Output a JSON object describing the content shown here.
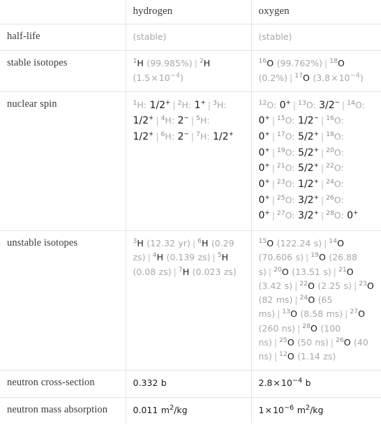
{
  "table": {
    "columns": [
      "",
      "hydrogen",
      "oxygen"
    ],
    "rows": [
      {
        "label": "half-life",
        "hydrogen": "(stable)",
        "oxygen": "(stable)"
      },
      {
        "label": "stable isotopes",
        "hydrogen": "1H (99.985%)  |  2H (1.5×10^-4)",
        "oxygen": "16O (99.762%)  |  18O (0.2%)  |  17O (3.8×10^-4)"
      },
      {
        "label": "nuclear spin",
        "hydrogen": "1H: 1/2+  |  2H: 1+  |  3H: 1/2+  |  4H: 2-  |  5H: 1/2+  |  6H: 2-  |  7H: 1/2+",
        "oxygen": "12O: 0+  |  13O: 3/2-  |  14O: 0+  |  15O: 1/2-  |  16O: 0+  |  17O: 5/2+  |  18O: 0+  |  19O: 5/2+  |  20O: 0+  |  21O: 5/2+  |  22O: 0+  |  23O: 1/2+  |  24O: 0+  |  25O: 3/2+  |  26O: 0+  |  27O: 3/2+  |  28O: 0+"
      },
      {
        "label": "unstable isotopes",
        "hydrogen": "3H (12.32 yr)  |  6H (0.29 zs)  |  4H (0.139 zs)  |  5H (0.08 zs)  |  7H (0.023 zs)",
        "oxygen": "15O (122.24 s)  |  14O (70.606 s)  |  19O (26.88 s)  |  20O (13.51 s)  |  21O (3.42 s)  |  22O (2.25 s)  |  23O (82 ms)  |  24O (65 ms)  |  13O (8.58 ms)  |  27O (260 ns)  |  28O (100 ns)  |  25O (50 ns)  |  26O (40 ns)  |  12O (1.14 zs)"
      },
      {
        "label": "neutron cross-section",
        "hydrogen": "0.332 b",
        "oxygen": "2.8×10^-4 b"
      },
      {
        "label": "neutron mass absorption",
        "hydrogen": "0.011 m^2/kg",
        "oxygen": "1×10^-6 m^2/kg"
      }
    ]
  },
  "labels": {
    "header_hydrogen": "hydrogen",
    "header_oxygen": "oxygen",
    "half_life": "half-life",
    "stable_isotopes": "stable isotopes",
    "nuclear_spin": "nuclear spin",
    "unstable_isotopes": "unstable isotopes",
    "neutron_cross_section": "neutron cross-section",
    "neutron_mass_absorption": "neutron mass absorption"
  },
  "values": {
    "half_life_hydrogen": "(stable)",
    "half_life_oxygen": "(stable)",
    "neutron_cs_hydrogen": "0.332 b",
    "neutron_ma_hydrogen_num": "0.011",
    "neutron_ma_oxygen_mantissa": "1"
  },
  "colors": {
    "border": "#e3e3e3",
    "text": "#3c3c3c",
    "dim_text": "#a8a8a8",
    "value_text": "#1a1a1a",
    "background": "#ffffff"
  }
}
